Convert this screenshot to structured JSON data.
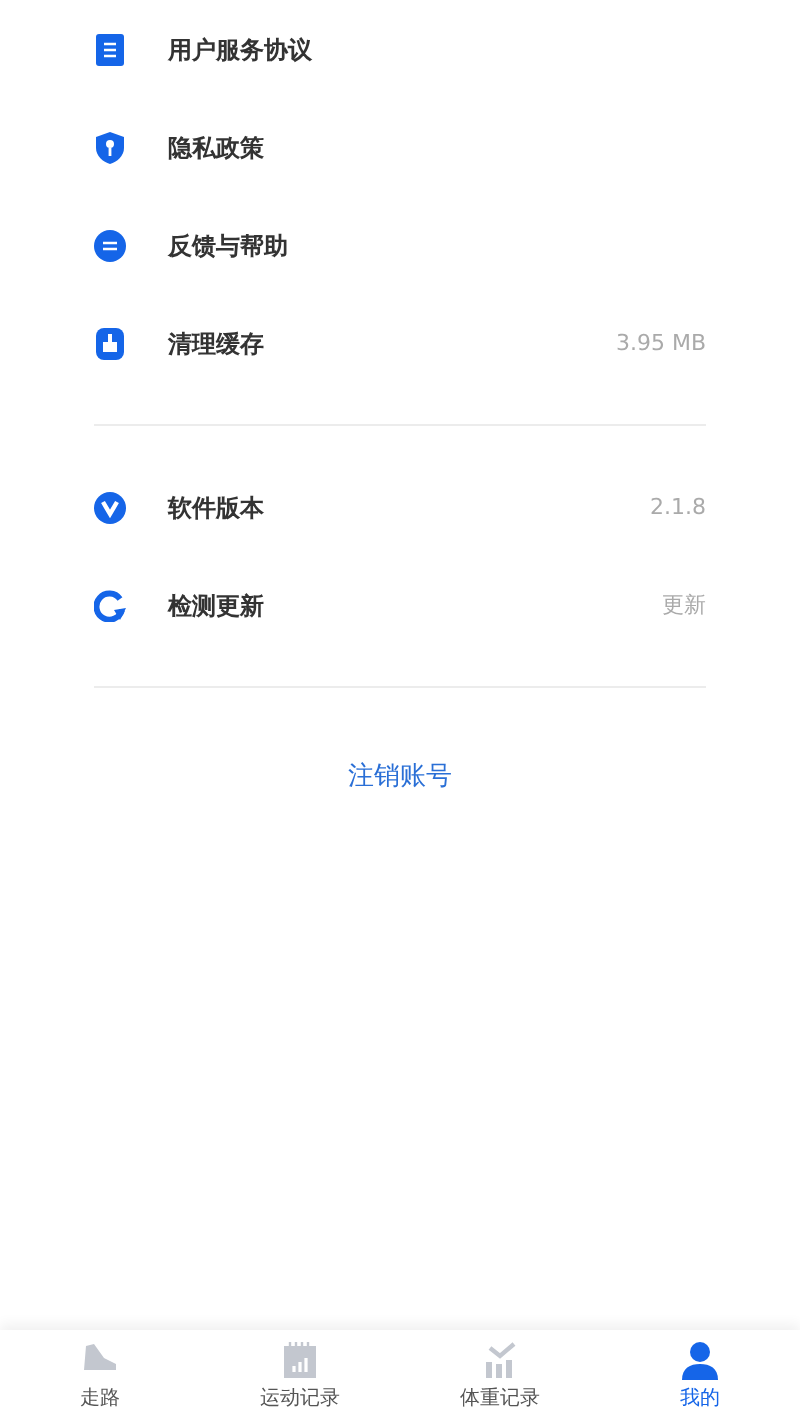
{
  "menu_groups": [
    {
      "items": [
        {
          "label": "用户服务协议"
        },
        {
          "label": "隐私政策"
        },
        {
          "label": "反馈与帮助"
        },
        {
          "label": "清理缓存",
          "value": "3.95 MB"
        }
      ]
    },
    {
      "items": [
        {
          "label": "软件版本",
          "value": "2.1.8"
        },
        {
          "label": "检测更新",
          "value": "更新"
        }
      ]
    }
  ],
  "logout_link": "注销账号",
  "tab_bar": [
    {
      "label": "走路",
      "selected": false
    },
    {
      "label": "运动记录",
      "selected": false
    },
    {
      "label": "体重记录",
      "selected": false
    },
    {
      "label": "我的",
      "selected": true
    }
  ]
}
